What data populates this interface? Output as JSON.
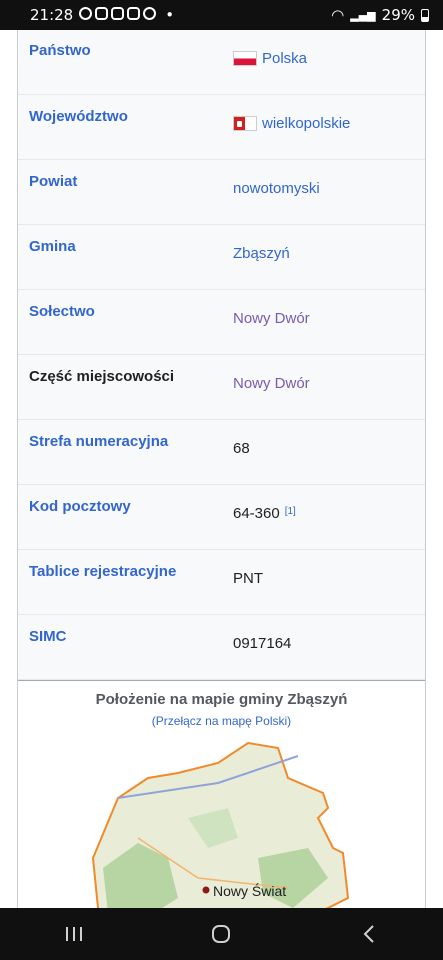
{
  "status": {
    "time": "21:28",
    "battery": "29%"
  },
  "infobox": [
    {
      "label": "Państwo",
      "value": "Polska",
      "style": "link",
      "label_style": "link",
      "flag": "pl"
    },
    {
      "label": "Województwo",
      "value": "wielkopolskie",
      "style": "link",
      "label_style": "link",
      "flag": "wlkp"
    },
    {
      "label": "Powiat",
      "value": "nowotomyski",
      "style": "link",
      "label_style": "link"
    },
    {
      "label": "Gmina",
      "value": "Zbąszyń",
      "style": "link",
      "label_style": "link"
    },
    {
      "label": "Sołectwo",
      "value": "Nowy Dwór",
      "style": "visited",
      "label_style": "link"
    },
    {
      "label": "Część miejscowości",
      "value": "Nowy Dwór",
      "style": "visited",
      "label_style": "black"
    },
    {
      "label": "Strefa numeracyjna",
      "value": "68",
      "style": "plain",
      "label_style": "link"
    },
    {
      "label": "Kod pocztowy",
      "value": "64-360",
      "ref": "[1]",
      "style": "plain",
      "label_style": "link"
    },
    {
      "label": "Tablice rejestracyjne",
      "value": "PNT",
      "style": "plain",
      "label_style": "link"
    },
    {
      "label": "SIMC",
      "value": "0917164",
      "style": "plain",
      "label_style": "link"
    }
  ],
  "map": {
    "title": "Położenie na mapie gminy Zbąszyń",
    "switch_link": "(Przełącz na mapę Polski)",
    "marker_label": "Nowy Świat",
    "border_color": "#f08a2a",
    "forest_color": "#aed09a"
  },
  "nav": {
    "recent_icon": "recent-apps-icon",
    "home_icon": "home-icon",
    "back_icon": "back-icon"
  }
}
